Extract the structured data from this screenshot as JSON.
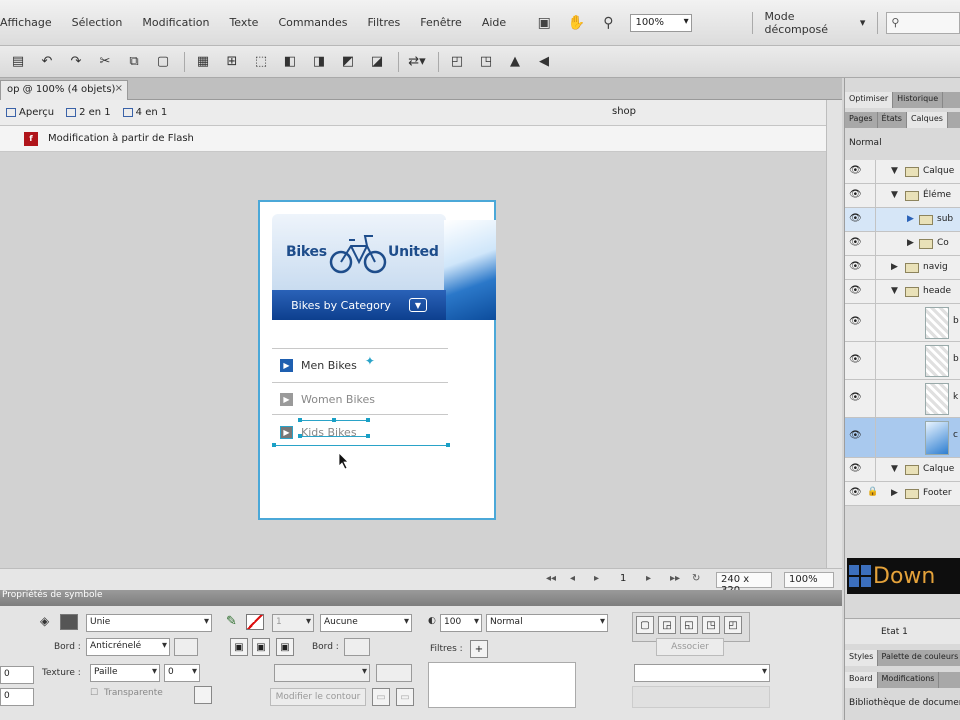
{
  "menubar": {
    "items": [
      "Affichage",
      "Sélection",
      "Modification",
      "Texte",
      "Commandes",
      "Filtres",
      "Fenêtre",
      "Aide"
    ],
    "zoom": "100%",
    "workspace": "Mode décomposé"
  },
  "document": {
    "tab_title": "op @ 100% (4 objets)",
    "tab_close": "×",
    "views": [
      "Aperçu",
      "2 en 1",
      "4 en 1"
    ],
    "page_name": "shop",
    "flash_notice": "Modification à partir de Flash"
  },
  "artboard": {
    "logo_left": "Bikes",
    "logo_right": "United",
    "category_label": "Bikes by Category",
    "nav": [
      "Men Bikes",
      "Women Bikes",
      "Kids Bikes"
    ]
  },
  "status": {
    "page": "1",
    "size": "240 x 320",
    "zoom": "100%"
  },
  "properties": {
    "header": "Propriétés de symbole",
    "fill_type": "Unie",
    "edge_label": "Bord :",
    "edge_value": "Anticrénelé",
    "texture_label": "Texture :",
    "texture_value": "Paille",
    "texture_pct": "0",
    "transparent_label": "Transparente",
    "stroke_size": "1",
    "stroke_type": "Aucune",
    "stroke_edge_label": "Bord :",
    "edit_outline_label": "Modifier le contour",
    "opacity": "100",
    "blend": "Normal",
    "filters_label": "Filtres :",
    "filters_add": "+",
    "assign_label": "Associer",
    "x_value": "0",
    "y_value": "0"
  },
  "rpanel": {
    "top_tabs": [
      "Optimiser",
      "Historique"
    ],
    "sub_tabs": [
      "Pages",
      "États",
      "Calques"
    ],
    "blend": "Normal",
    "layers": [
      {
        "name": "Calque",
        "type": "folder"
      },
      {
        "name": "Éléme",
        "type": "folder"
      },
      {
        "name": "sub",
        "type": "folder"
      },
      {
        "name": "Co",
        "type": "folder"
      },
      {
        "name": "navig",
        "type": "folder"
      },
      {
        "name": "heade",
        "type": "folder"
      },
      {
        "name": "b",
        "type": "thumb"
      },
      {
        "name": "b",
        "type": "thumb"
      },
      {
        "name": "k",
        "type": "thumb"
      },
      {
        "name": "c",
        "type": "thumb-blue"
      },
      {
        "name": "Calque",
        "type": "folder"
      },
      {
        "name": "Footer",
        "type": "folder"
      }
    ],
    "ad_text": "Down",
    "state_label": "Etat 1",
    "styles_tabs": [
      "Styles",
      "Palette de couleurs"
    ],
    "lower_tabs": [
      "Board",
      "Modifications"
    ],
    "library_label": "Bibliothèque de document"
  }
}
